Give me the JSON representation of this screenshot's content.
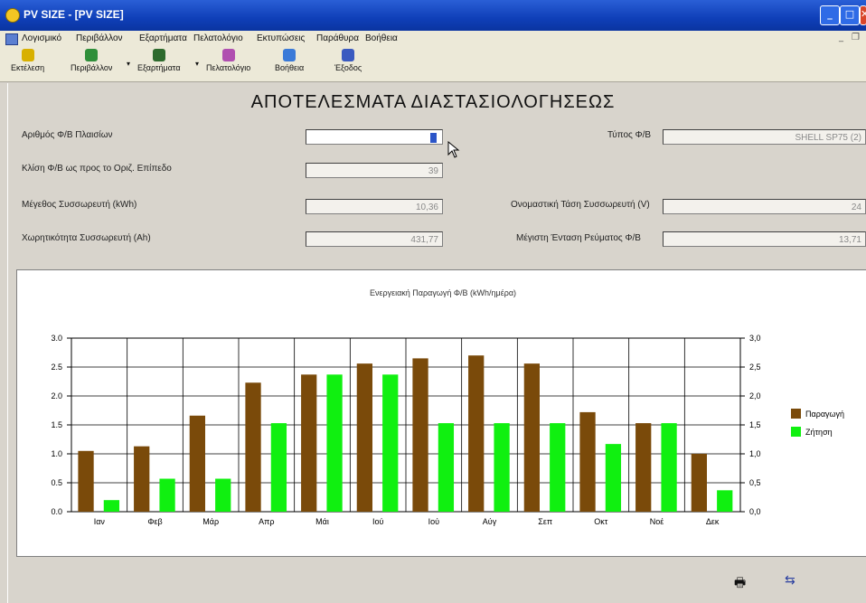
{
  "window": {
    "title": "PV SIZE - [PV SIZE]",
    "min": "_",
    "max": "□",
    "close": "✕"
  },
  "menu": {
    "items": [
      "Λογισμικό",
      "Περιβάλλον",
      "Εξαρτήματα",
      "Πελατολόγιο",
      "Εκτυπώσεις",
      "Παράθυρα",
      "Βοήθεια"
    ],
    "mdi_min": "_",
    "mdi_restore": "❐"
  },
  "toolbar": {
    "buttons": [
      {
        "label": "Εκτέλεση",
        "color": "#d8b000"
      },
      {
        "label": "Περιβάλλον",
        "color": "#2f8f3a"
      },
      {
        "label": "Εξαρτήματα",
        "color": "#2d6a2d"
      },
      {
        "label": "Πελατολόγιο",
        "color": "#b04fb0"
      },
      {
        "label": "Βοήθεια",
        "color": "#3a7ad8"
      },
      {
        "label": "Έξοδος",
        "color": "#3a5ac0"
      }
    ]
  },
  "heading": "ΑΠΟΤΕΛΕΣΜΑΤΑ ΔΙΑΣΤΑΣΙΟΛΟΓΗΣΕΩΣ",
  "form": {
    "panels_label": "Αριθμός Φ/Β Πλαισίων",
    "panels_value": "",
    "tilt_label": "Κλίση Φ/Β ως προς το Οριζ. Επίπεδο",
    "tilt_value": "39",
    "battery_size_label": "Μέγεθος Συσσωρευτή (kWh)",
    "battery_size_value": "10,36",
    "battery_capacity_label": "Χωρητικότητα Συσσωρευτή (Ah)",
    "battery_capacity_value": "431,77",
    "pv_type_label": "Τύπος Φ/Β",
    "pv_type_value": "SHELL SP75 (2)",
    "nominal_voltage_label": "Ονομαστική Τάση Συσσωρευτή (V)",
    "nominal_voltage_value": "24",
    "max_current_label": "Μέγιστη Ένταση Ρεύματος Φ/Β",
    "max_current_value": "13,71"
  },
  "chart_data": {
    "type": "bar",
    "title": "Ενεργειακή Παραγωγή Φ/Β (kWh/ημέρα)",
    "categories": [
      "Ιαν",
      "Φεβ",
      "Μάρ",
      "Απρ",
      "Μάι",
      "Ιού",
      "Ιού",
      "Αύγ",
      "Σεπ",
      "Οκτ",
      "Νοέ",
      "Δεκ"
    ],
    "series": [
      {
        "name": "Παραγωγή",
        "color": "#7a4a0a",
        "values": [
          1.05,
          1.13,
          1.66,
          2.23,
          2.37,
          2.56,
          2.65,
          2.7,
          2.56,
          1.72,
          1.53,
          1.0
        ]
      },
      {
        "name": "Ζήτηση",
        "color": "#10f010",
        "values": [
          0.2,
          0.57,
          0.57,
          1.53,
          2.37,
          2.37,
          1.53,
          1.53,
          1.53,
          1.17,
          1.53,
          0.37
        ]
      }
    ],
    "yticks_left": [
      "0.0",
      "0.5",
      "1.0",
      "1.5",
      "2.0",
      "2.5",
      "3.0"
    ],
    "yticks_right": [
      "0,0",
      "0,5",
      "1,0",
      "1,5",
      "2,0",
      "2,5",
      "3,0"
    ],
    "ylim": [
      0,
      3
    ],
    "grid": true,
    "legend": "right"
  },
  "footer": {
    "print_icon": "🖶",
    "nav_icon": "⇆"
  }
}
